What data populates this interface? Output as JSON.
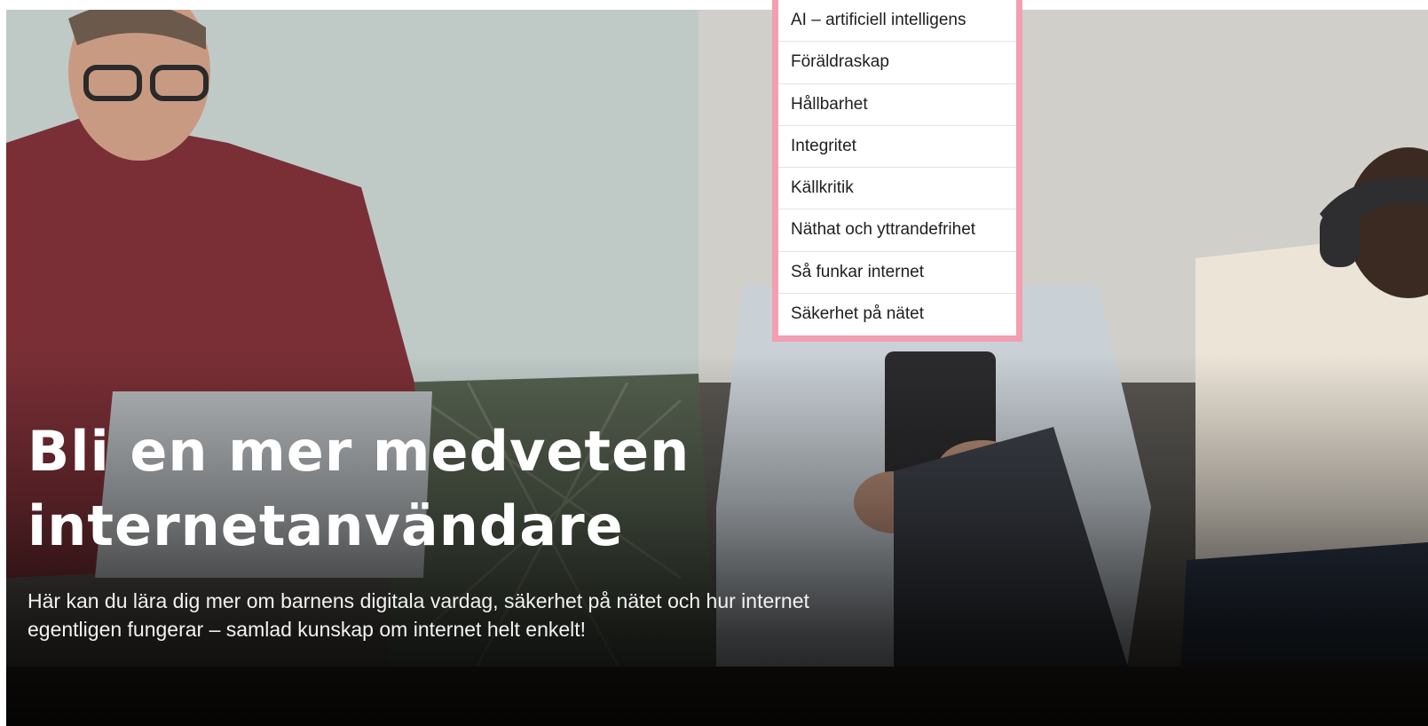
{
  "hero": {
    "title": "Bli en mer medveten internetanvändare",
    "lead": "Här kan du lära dig mer om barnens digitala vardag, säkerhet på nätet och hur internet egentligen fungerar – samlad kunskap om internet helt enkelt!"
  },
  "dropdown": {
    "items": [
      {
        "label": "AI – artificiell intelligens"
      },
      {
        "label": "Föräldraskap"
      },
      {
        "label": "Hållbarhet"
      },
      {
        "label": "Integritet"
      },
      {
        "label": "Källkritik"
      },
      {
        "label": "Näthat och yttrandefrihet"
      },
      {
        "label": "Så funkar internet"
      },
      {
        "label": "Säkerhet på nätet"
      }
    ]
  },
  "colors": {
    "menu_border": "#f29fb1",
    "menu_background": "#ffffff",
    "hero_text": "#ffffff"
  }
}
